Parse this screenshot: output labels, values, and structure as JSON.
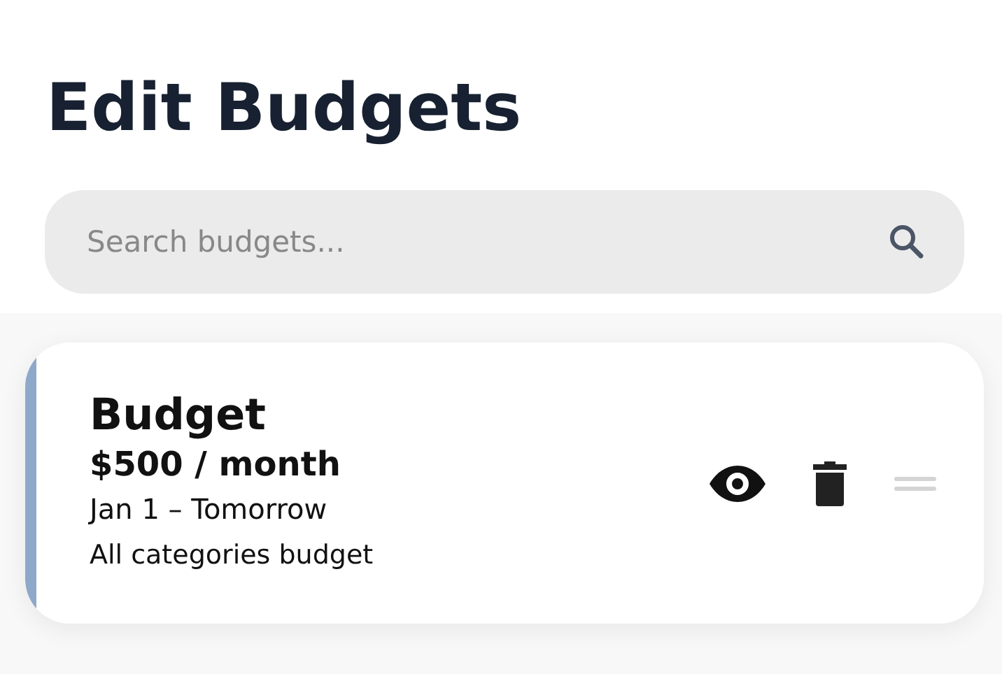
{
  "title": "Edit Budgets",
  "search": {
    "placeholder": "Search budgets..."
  },
  "budgets": [
    {
      "name": "Budget",
      "amount": "$500",
      "period": "/ month",
      "dates": "Jan 1 – Tomorrow",
      "description": "All categories budget",
      "color": "#8ea8c9"
    }
  ]
}
